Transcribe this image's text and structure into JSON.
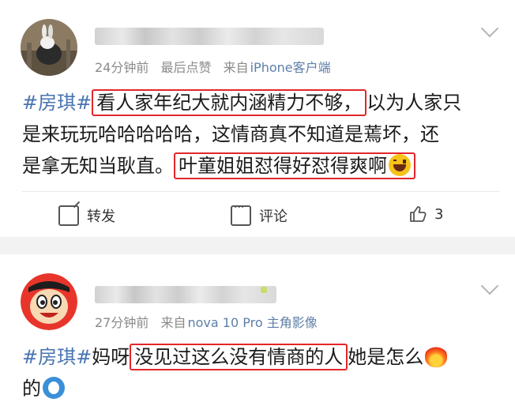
{
  "posts": [
    {
      "time": "24分钟前",
      "label": "最后点赞",
      "source": "来自",
      "device": "iPhone客户端",
      "lines": {
        "l1_topic": "#房琪#",
        "l1_hl": "看人家年纪大就内涵精力不够，",
        "l1_rest": "以为人家只",
        "l2": "是来玩玩哈哈哈哈哈，这情商真不知道是蔫坏，还",
        "l3_text": "是拿无知当耿直。",
        "l3_hl": "叶童姐姐怼得好怼得爽啊"
      },
      "emoji": "grinning-face",
      "actions": {
        "repost": "转发",
        "comment": "评论",
        "like_count": "3"
      }
    },
    {
      "time": "27分钟前",
      "source": "来自",
      "device": "nova 10 Pro 主角影像",
      "lines": {
        "l1_topic": "#房琪#",
        "l1_pre": "妈呀",
        "l1_hl": "没见过这么没有情商的人",
        "l1_rest": "她是怎么",
        "l2": "的"
      },
      "emojis": [
        "fire",
        "blue-face"
      ]
    }
  ]
}
